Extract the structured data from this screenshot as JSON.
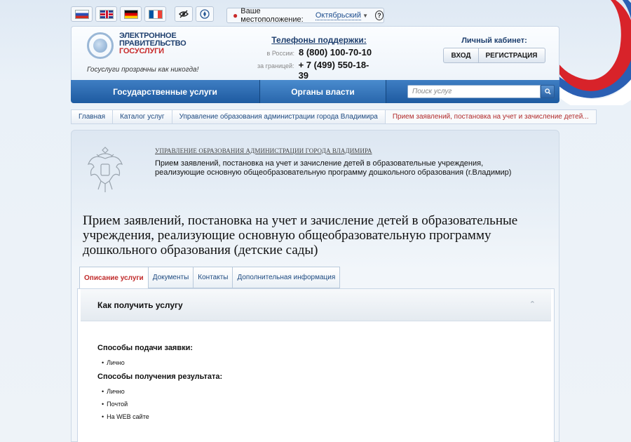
{
  "header": {
    "languages": [
      "Русский",
      "English",
      "Deutsch",
      "Français"
    ],
    "location_label": "Ваше местоположение:",
    "location_value": "Октябрьский",
    "help": "?",
    "logo_line1": "ЭЛЕКТРОННОЕ",
    "logo_line2": "ПРАВИТЕЛЬСТВО",
    "logo_line3": "ГОСУСЛУГИ",
    "slogan": "Госуслуги прозрачны как никогда!",
    "phones_title": "Телефоны поддержки:",
    "phone_ru_label": "в России:",
    "phone_ru": "8 (800) 100-70-10",
    "phone_abroad_label": "за границей:",
    "phone_abroad": "+ 7 (499) 550-18-39",
    "cabinet_title": "Личный кабинет:",
    "login": "ВХОД",
    "register": "РЕГИСТРАЦИЯ"
  },
  "nav": {
    "services": "Государственные услуги",
    "authorities": "Органы власти",
    "search_placeholder": "Поиск услуг"
  },
  "breadcrumbs": [
    "Главная",
    "Каталог услуг",
    "Управление образования администрации города Владимира",
    "Прием заявлений, постановка на учет и зачисление детей..."
  ],
  "org": {
    "name": "УПРАВЛЕНИЕ ОБРАЗОВАНИЯ АДМИНИСТРАЦИИ ГОРОДА ВЛАДИМИРА",
    "description": "Прием заявлений, постановка на учет и зачисление детей в образовательные учреждения, реализующие основную общеобразовательную программу дошкольного образования (г.Владимир)"
  },
  "title": "Прием заявлений, постановка на учет и зачисление детей в образовательные учреждения, реализующие основную общеобразовательную программу дошкольного образования (детские сады)",
  "tabs": [
    "Описание услуги",
    "Документы",
    "Контакты",
    "Дополнительная информация"
  ],
  "accordion": {
    "title": "Как получить услугу",
    "submit_title": "Способы подачи заявки:",
    "submit_items": [
      "Лично"
    ],
    "result_title": "Способы получения результата:",
    "result_items": [
      "Лично",
      "Почтой",
      "На WEB сайте"
    ]
  },
  "colors": {
    "nav_blue": "#1d5aa0",
    "active_tab": "#c02b2b",
    "link": "#1e4a80"
  }
}
